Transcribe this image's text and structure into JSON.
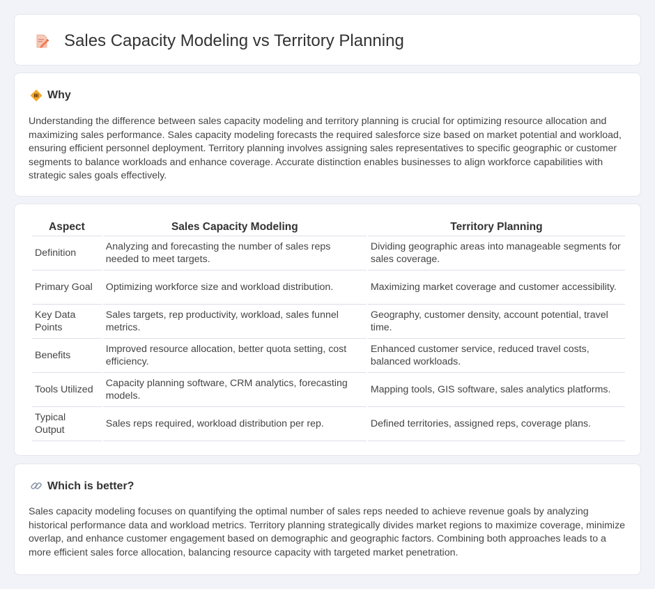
{
  "header": {
    "title": "Sales Capacity Modeling vs Territory Planning",
    "icon": "pencil-doc-icon"
  },
  "why": {
    "title": "Why",
    "icon": "diamond-sign-icon",
    "text": "Understanding the difference between sales capacity modeling and territory planning is crucial for optimizing resource allocation and maximizing sales performance. Sales capacity modeling forecasts the required salesforce size based on market potential and workload, ensuring efficient personnel deployment. Territory planning involves assigning sales representatives to specific geographic or customer segments to balance workloads and enhance coverage. Accurate distinction enables businesses to align workforce capabilities with strategic sales goals effectively."
  },
  "table": {
    "headers": [
      "Aspect",
      "Sales Capacity Modeling",
      "Territory Planning"
    ],
    "rows": [
      [
        "Definition",
        "Analyzing and forecasting the number of sales reps needed to meet targets.",
        "Dividing geographic areas into manageable segments for sales coverage."
      ],
      [
        "Primary Goal",
        "Optimizing workforce size and workload distribution.",
        "Maximizing market coverage and customer accessibility."
      ],
      [
        "Key Data Points",
        "Sales targets, rep productivity, workload, sales funnel metrics.",
        "Geography, customer density, account potential, travel time."
      ],
      [
        "Benefits",
        "Improved resource allocation, better quota setting, cost efficiency.",
        "Enhanced customer service, reduced travel costs, balanced workloads."
      ],
      [
        "Tools Utilized",
        "Capacity planning software, CRM analytics, forecasting models.",
        "Mapping tools, GIS software, sales analytics platforms."
      ],
      [
        "Typical Output",
        "Sales reps required, workload distribution per rep.",
        "Defined territories, assigned reps, coverage plans."
      ]
    ]
  },
  "better": {
    "title": "Which is better?",
    "icon": "link-icon",
    "text": "Sales capacity modeling focuses on quantifying the optimal number of sales reps needed to achieve revenue goals by analyzing historical performance data and workload metrics. Territory planning strategically divides market regions to maximize coverage, minimize overlap, and enhance customer engagement based on demographic and geographic factors. Combining both approaches leads to a more efficient sales force allocation, balancing resource capacity with targeted market penetration."
  }
}
